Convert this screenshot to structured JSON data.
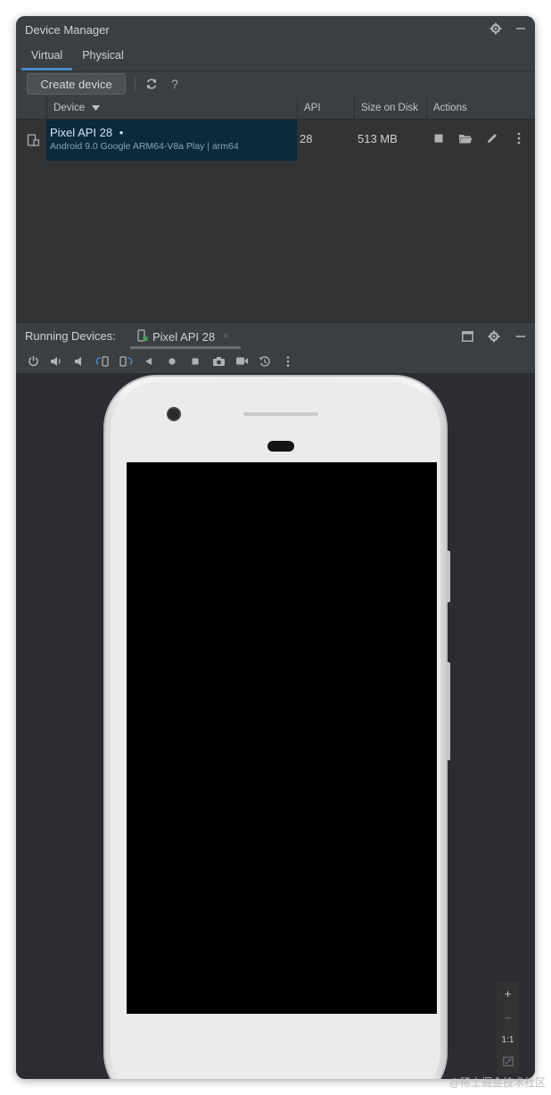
{
  "window": {
    "title": "Device Manager",
    "tabs": [
      {
        "label": "Virtual",
        "active": true
      },
      {
        "label": "Physical",
        "active": false
      }
    ]
  },
  "toolbar": {
    "create_label": "Create device",
    "help_label": "?"
  },
  "table": {
    "headers": {
      "device": "Device",
      "api": "API",
      "size": "Size on Disk",
      "actions": "Actions"
    },
    "rows": [
      {
        "name": "Pixel API 28",
        "status_dot": "•",
        "subtitle": "Android 9.0 Google ARM64-V8a Play | arm64",
        "api": "28",
        "size": "513 MB"
      }
    ]
  },
  "running": {
    "label": "Running Devices:",
    "tab_label": "Pixel API 28",
    "tab_close": "×"
  },
  "zoom": {
    "plus": "+",
    "minus": "−",
    "fit": "1:1"
  },
  "watermark": "@稀土掘金技术社区",
  "colors": {
    "accent": "#4a88c7",
    "selection": "#0d293e",
    "panel": "#3c3f41",
    "background": "#2b2d30"
  }
}
